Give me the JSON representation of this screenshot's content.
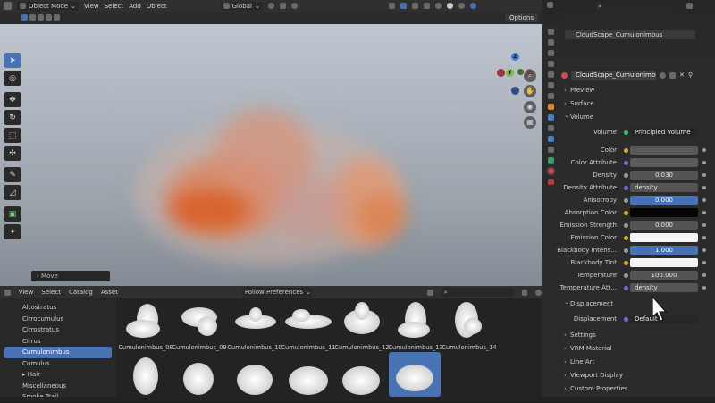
{
  "header": {
    "mode": "Object Mode",
    "menus": [
      "View",
      "Select",
      "Add",
      "Object"
    ],
    "transform": "Global"
  },
  "viewport": {
    "options_label": "Options",
    "operator_panel": "Move",
    "gizmo_axes": [
      "Z",
      "Y",
      "X"
    ]
  },
  "asset_browser": {
    "menus": [
      "View",
      "Select",
      "Catalog",
      "Asset"
    ],
    "filter": "Follow Preferences",
    "catalogs": [
      {
        "label": "Altostratus",
        "selected": false
      },
      {
        "label": "Cirrocumulus",
        "selected": false
      },
      {
        "label": "Cirrostratus",
        "selected": false
      },
      {
        "label": "Cirrus",
        "selected": false
      },
      {
        "label": "Cumulonimbus",
        "selected": true
      },
      {
        "label": "Cumulus",
        "selected": false
      },
      {
        "label": "Hair",
        "selected": false
      },
      {
        "label": "Miscellaneous",
        "selected": false
      },
      {
        "label": "Smoke Trail",
        "selected": false
      }
    ],
    "assets": [
      "Cumulonimbus_08",
      "Cumulonimbus_09",
      "Cumulonimbus_10",
      "Cumulonimbus_11",
      "Cumulonimbus_12",
      "Cumulonimbus_13",
      "Cumulonimbus_14"
    ]
  },
  "outliner": {
    "item": "CloudScape_Cumulonimbus"
  },
  "properties": {
    "material_name": "CloudScape_Cumulonimbus",
    "sections_top": [
      "Preview",
      "Surface",
      "Volume"
    ],
    "volume_shader": {
      "label": "Volume",
      "value": "Principled Volume"
    },
    "rows": [
      {
        "label": "Color",
        "value": "",
        "dot": "#c7b32c",
        "style": "grey"
      },
      {
        "label": "Color Attribute",
        "value": "",
        "dot": "#6f6fd0",
        "style": "grey"
      },
      {
        "label": "Density",
        "value": "0.030",
        "dot": "#9a9a9a",
        "style": "num"
      },
      {
        "label": "Density Attribute",
        "value": "density",
        "dot": "#6f6fd0",
        "style": "text"
      },
      {
        "label": "Anisotropy",
        "value": "0.000",
        "dot": "#9a9a9a",
        "style": "blue"
      },
      {
        "label": "Absorption Color",
        "value": "",
        "dot": "#c7b32c",
        "style": "black"
      },
      {
        "label": "Emission Strength",
        "value": "0.000",
        "dot": "#9a9a9a",
        "style": "num"
      },
      {
        "label": "Emission Color",
        "value": "",
        "dot": "#c7b32c",
        "style": "white"
      },
      {
        "label": "Blackbody Intens...",
        "value": "1.000",
        "dot": "#9a9a9a",
        "style": "blue"
      },
      {
        "label": "Blackbody Tint",
        "value": "",
        "dot": "#c7b32c",
        "style": "white"
      },
      {
        "label": "Temperature",
        "value": "100.000",
        "dot": "#9a9a9a",
        "style": "num"
      },
      {
        "label": "Temperature Att...",
        "value": "density",
        "dot": "#6f6fd0",
        "style": "text"
      }
    ],
    "displacement_section": "Displacement",
    "displacement": {
      "label": "Displacement",
      "value": "Default"
    },
    "sections_bottom": [
      "Settings",
      "VRM Material",
      "Line Art",
      "Viewport Display",
      "Custom Properties"
    ]
  }
}
